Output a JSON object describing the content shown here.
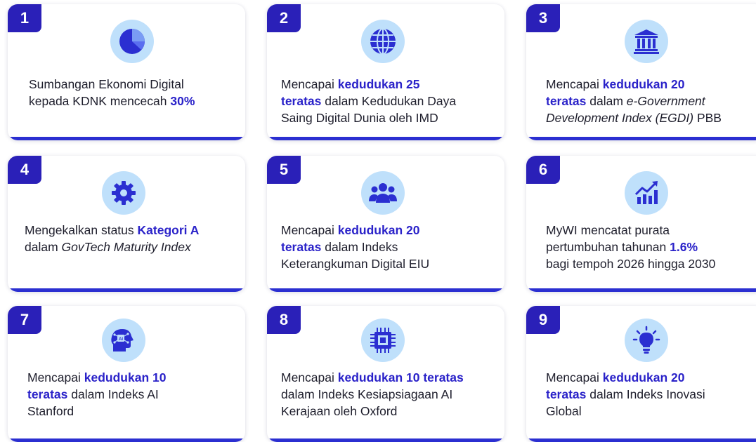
{
  "cards": [
    {
      "number": "1",
      "icon": "pie-chart-icon",
      "t1": "Sumbangan Ekonomi Digital",
      "t2": "kepada KDNK mencecah ",
      "t3": "30%"
    },
    {
      "number": "2",
      "icon": "globe-icon",
      "t1": "Mencapai ",
      "t2": "kedudukan 25",
      "t3": "teratas",
      "t4": " dalam Kedudukan Daya",
      "t5": "Saing Digital Dunia oleh IMD"
    },
    {
      "number": "3",
      "icon": "government-building-icon",
      "t1": "Mencapai ",
      "t2": "kedudukan 20",
      "t3": "teratas",
      "t4": " dalam ",
      "t5": "e-Government",
      "t6": "Development Index (EGDI)",
      "t7": " PBB"
    },
    {
      "number": "4",
      "icon": "gear-icon",
      "t1": "Mengekalkan status ",
      "t2": "Kategori A",
      "t3": "dalam ",
      "t4": "GovTech Maturity Index"
    },
    {
      "number": "5",
      "icon": "people-group-icon",
      "t1": "Mencapai ",
      "t2": "kedudukan 20",
      "t3": "teratas",
      "t4": " dalam Indeks",
      "t5": "Keterangkuman Digital EIU"
    },
    {
      "number": "6",
      "icon": "growth-chart-icon",
      "t1": "MyWI mencatat purata",
      "t2": "pertumbuhan tahunan ",
      "t3": "1.6%",
      "t4": "bagi tempoh 2026 hingga 2030"
    },
    {
      "number": "7",
      "icon": "ai-head-icon",
      "t1": "Mencapai ",
      "t2": "kedudukan 10",
      "t3": "teratas",
      "t4": " dalam Indeks AI",
      "t5": "Stanford"
    },
    {
      "number": "8",
      "icon": "microchip-icon",
      "t1": "Mencapai ",
      "t2": "kedudukan 10 teratas",
      "t3": "dalam Indeks Kesiapsiagaan AI",
      "t4": "Kerajaan oleh Oxford"
    },
    {
      "number": "9",
      "icon": "lightbulb-icon",
      "t1": "Mencapai ",
      "t2": "kedudukan 20",
      "t3": "teratas",
      "t4": " dalam Indeks Inovasi",
      "t5": "Global"
    }
  ],
  "colors": {
    "accent": "#2a20b8",
    "highlight_text": "#2a22c9",
    "icon_circle": "#bfe0fb",
    "icon_fill": "#2b2fd1"
  }
}
